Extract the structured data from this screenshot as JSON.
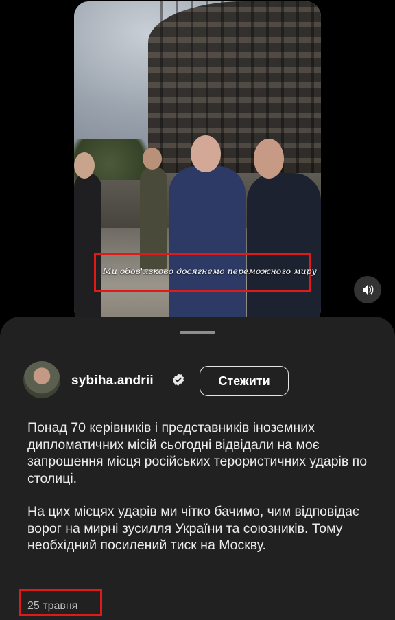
{
  "video": {
    "caption": "Ми обов'язково досягнемо переможного миру",
    "sound_icon": "speaker-icon"
  },
  "post": {
    "username": "sybiha.andrii",
    "verified_icon": "verified-badge-icon",
    "follow_label": "Стежити",
    "paragraph_1": "Понад 70 керівників і представників іноземних дипломатичних місій сьогодні відвідали на моє запрошення місця російських терористичних ударів по столиці.",
    "paragraph_2": "На цих місцях ударів ми чітко бачимо, чим відповідає ворог на мирні зусилля України та союзників. Тому необхідний посилений тиск на Москву.",
    "date": "25 травня"
  },
  "colors": {
    "background": "#000000",
    "sheet": "#212121",
    "highlight_box": "#e01919"
  }
}
